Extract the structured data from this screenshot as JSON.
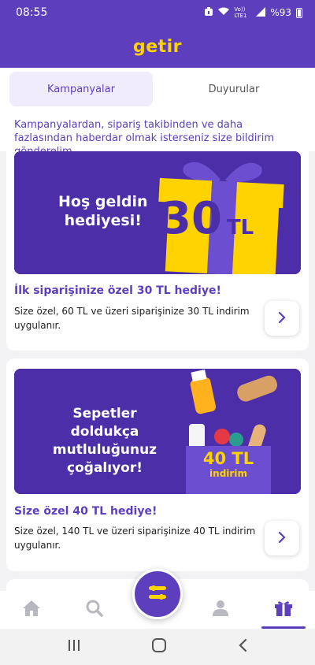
{
  "status_bar": {
    "time": "08:55",
    "network": "Vo)) LTE1",
    "battery": "%93"
  },
  "header": {
    "logo": "getir"
  },
  "tabs": [
    {
      "label": "Kampanyalar",
      "active": true
    },
    {
      "label": "Duyurular",
      "active": false
    }
  ],
  "info_text": "Kampanyalardan, sipariş takibinden ve daha fazlasından haberdar olmak isterseniz size bildirim gönderelim.",
  "campaigns": [
    {
      "banner_line1": "Hoş geldin",
      "banner_line2": "hediyesi!",
      "banner_amount": "30",
      "banner_currency": "TL",
      "title": "İlk siparişinize özel 30 TL hediye!",
      "description": "Size özel, 60 TL ve üzeri siparişinize 30 TL indirim uygulanır."
    },
    {
      "banner_line1": "Sepetler doldukça",
      "banner_line2": "mutluluğunuz",
      "banner_line3": "çoğalıyor!",
      "banner_amount": "40 TL",
      "banner_sub": "indirim",
      "title": "Size özel 40 TL hediye!",
      "description": "Size özel, 140 TL ve üzeri siparişinize 40 TL indirim uygulanır."
    }
  ],
  "bottom_nav": [
    {
      "icon": "home-icon"
    },
    {
      "icon": "search-icon"
    },
    {
      "icon": "getir-menu-icon"
    },
    {
      "icon": "profile-icon"
    },
    {
      "icon": "gift-icon",
      "active": true
    }
  ],
  "colors": {
    "brand": "#5d3ebc",
    "accent": "#ffd300",
    "banner": "#4b2ea8"
  }
}
